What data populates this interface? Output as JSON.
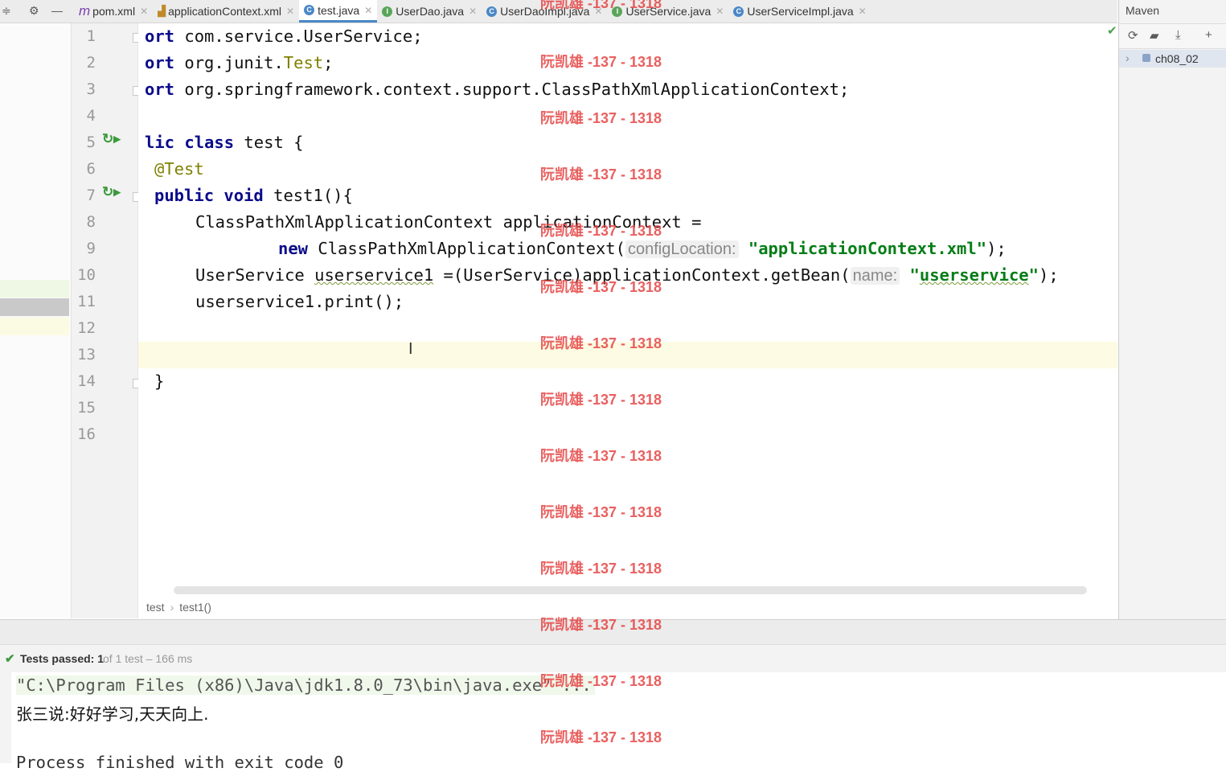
{
  "tabs": [
    {
      "label": "pom.xml",
      "icon": "m",
      "color": "#7a3fb0"
    },
    {
      "label": "applicationContext.xml",
      "icon": "spring",
      "color": "#c08a2a"
    },
    {
      "label": "test.java",
      "icon": "C",
      "color": "#4a88c7",
      "active": true
    },
    {
      "label": "UserDao.java",
      "icon": "I",
      "color": "#5aa55a"
    },
    {
      "label": "UserDaoImpl.java",
      "icon": "C",
      "color": "#4a88c7"
    },
    {
      "label": "UserService.java",
      "icon": "I",
      "color": "#5aa55a"
    },
    {
      "label": "UserServiceImpl.java",
      "icon": "C",
      "color": "#4a88c7"
    }
  ],
  "editor": {
    "line_numbers": [
      "1",
      "2",
      "3",
      "4",
      "5",
      "6",
      "7",
      "8",
      "9",
      "10",
      "11",
      "12",
      "13",
      "14",
      "15",
      "16"
    ],
    "code": {
      "l1_kw": "ort",
      "l1_rest": " com.service.UserService;",
      "l2_kw": "ort",
      "l2_rest": " org.junit.",
      "l2_type": "Test",
      "l2_end": ";",
      "l3_kw": "ort",
      "l3_rest": " org.springframework.context.support.ClassPathXmlApplicationContext;",
      "l5_kw1": "lic",
      "l5_kw2": "class",
      "l5_rest": " test {",
      "l6_ann": "@Test",
      "l7_kw1": "public",
      "l7_kw2": "void",
      "l7_rest": " test1(){",
      "l8": "ClassPathXmlApplicationContext applicationContext =",
      "l9_kw": "new",
      "l9_rest": " ClassPathXmlApplicationContext(",
      "l9_hint": "configLocation:",
      "l9_str": "\"applicationContext.xml\"",
      "l9_end": ");",
      "l10_a": "UserService ",
      "l10_var": "userservice1",
      "l10_b": " =(UserService)applicationContext.getBean(",
      "l10_hint": "name:",
      "l10_q1": "\"",
      "l10_str": "userservice",
      "l10_q2": "\"",
      "l10_end": ");",
      "l11": "userservice1.print();",
      "l14": "}"
    },
    "breadcrumb": [
      "test",
      "test1()"
    ]
  },
  "maven": {
    "title": "Maven",
    "project": "ch08_02"
  },
  "run": {
    "status_label": "Tests passed: 1",
    "status_sub": "of 1 test – 166 ms",
    "console": [
      "\"C:\\Program Files (x86)\\Java\\jdk1.8.0_73\\bin\\java.exe\" ...",
      "张三说:好好学习,天天向上.",
      "Process finished with exit code 0"
    ]
  },
  "watermark": "阮凯雄 -137 - 1318"
}
